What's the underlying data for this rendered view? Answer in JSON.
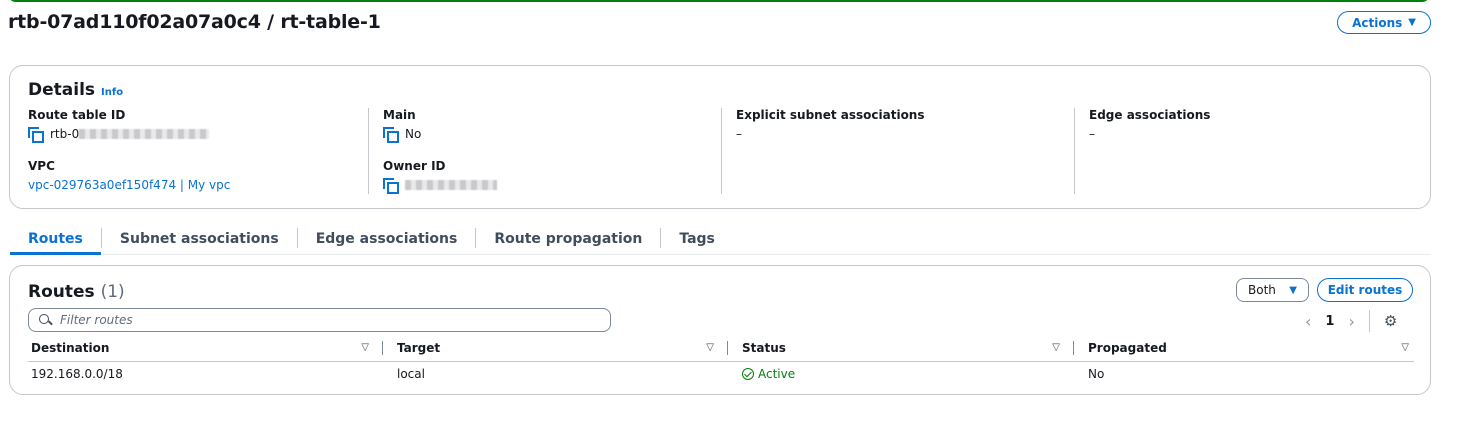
{
  "page": {
    "title": "rtb-07ad110f02a07a0c4 / rt-table-1",
    "actions_label": "Actions"
  },
  "details": {
    "title": "Details",
    "info": "Info",
    "fields": {
      "route_table_id_label": "Route table ID",
      "route_table_id_value": "rtb-0",
      "vpc_label": "VPC",
      "vpc_value": "vpc-029763a0ef150f474 | My vpc",
      "main_label": "Main",
      "main_value": "No",
      "owner_id_label": "Owner ID",
      "explicit_label": "Explicit subnet associations",
      "explicit_value": "–",
      "edge_label": "Edge associations",
      "edge_value": "–"
    }
  },
  "tabs": [
    "Routes",
    "Subnet associations",
    "Edge associations",
    "Route propagation",
    "Tags"
  ],
  "routes": {
    "title": "Routes",
    "count": "(1)",
    "filter_selected": "Both",
    "edit_label": "Edit routes",
    "filter_placeholder": "Filter routes",
    "page_number": "1",
    "columns": [
      "Destination",
      "Target",
      "Status",
      "Propagated"
    ],
    "rows": [
      {
        "destination": "192.168.0.0/18",
        "target": "local",
        "status": "Active",
        "propagated": "No"
      }
    ]
  },
  "colors": {
    "accent": "#0972d3",
    "success": "#037f0c",
    "border": "#c6c6cd"
  },
  "icons": [
    "copy-icon",
    "search-icon",
    "gear-icon",
    "check-circle-icon",
    "caret-down-icon",
    "sort-icon"
  ]
}
